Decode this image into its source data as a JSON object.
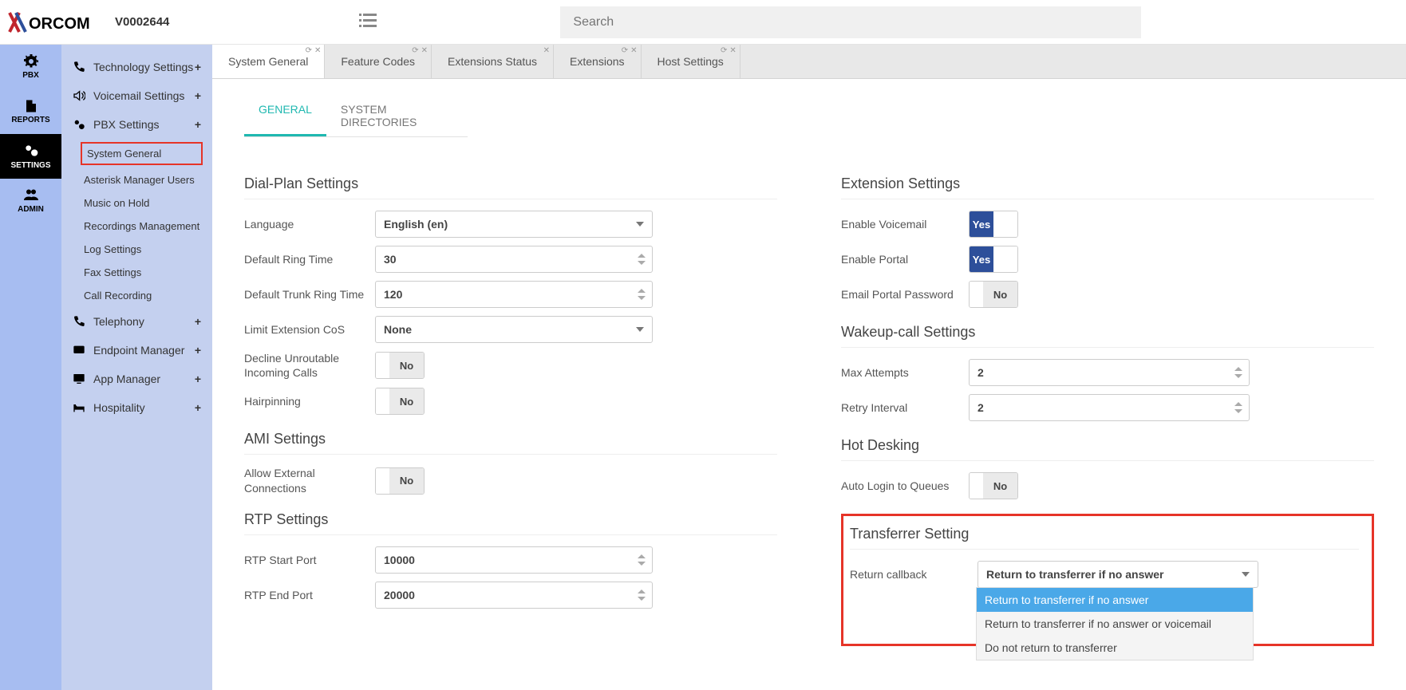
{
  "brand": {
    "name": "XORCOM",
    "version": "V0002644"
  },
  "search": {
    "placeholder": "Search"
  },
  "rail": [
    {
      "id": "pbx",
      "label": "PBX"
    },
    {
      "id": "reports",
      "label": "REPORTS"
    },
    {
      "id": "settings",
      "label": "SETTINGS"
    },
    {
      "id": "admin",
      "label": "ADMIN"
    }
  ],
  "sidebar": {
    "groups": [
      {
        "id": "tech",
        "label": "Technology Settings"
      },
      {
        "id": "voicemail",
        "label": "Voicemail Settings"
      },
      {
        "id": "pbx",
        "label": "PBX Settings"
      }
    ],
    "pbx_subs": [
      {
        "id": "sysgen",
        "label": "System General",
        "hl": true
      },
      {
        "id": "ami",
        "label": "Asterisk Manager Users"
      },
      {
        "id": "moh",
        "label": "Music on Hold"
      },
      {
        "id": "rec",
        "label": "Recordings Management"
      },
      {
        "id": "log",
        "label": "Log Settings"
      },
      {
        "id": "fax",
        "label": "Fax Settings"
      },
      {
        "id": "callrec",
        "label": "Call Recording"
      }
    ],
    "groups2": [
      {
        "id": "tel",
        "label": "Telephony"
      },
      {
        "id": "endpoint",
        "label": "Endpoint Manager"
      },
      {
        "id": "appmgr",
        "label": "App Manager"
      },
      {
        "id": "hosp",
        "label": "Hospitality"
      }
    ]
  },
  "tabs": [
    {
      "id": "sysgen",
      "label": "System General",
      "active": true
    },
    {
      "id": "feat",
      "label": "Feature Codes"
    },
    {
      "id": "extstat",
      "label": "Extensions Status"
    },
    {
      "id": "ext",
      "label": "Extensions"
    },
    {
      "id": "host",
      "label": "Host Settings"
    }
  ],
  "subtabs": {
    "general": "GENERAL",
    "sysdir": "SYSTEM DIRECTORIES"
  },
  "left": {
    "dialplan": {
      "title": "Dial-Plan Settings",
      "language_label": "Language",
      "language_value": "English (en)",
      "defring_label": "Default Ring Time",
      "defring_value": "30",
      "deftrunk_label": "Default Trunk Ring Time",
      "deftrunk_value": "120",
      "limitcos_label": "Limit Extension CoS",
      "limitcos_value": "None",
      "decline_label": "Decline Unroutable Incoming Calls",
      "decline_value": "No",
      "hairpin_label": "Hairpinning",
      "hairpin_value": "No"
    },
    "ami": {
      "title": "AMI Settings",
      "allowext_label": "Allow External Connections",
      "allowext_value": "No"
    },
    "rtp": {
      "title": "RTP Settings",
      "start_label": "RTP Start Port",
      "start_value": "10000",
      "end_label": "RTP End Port",
      "end_value": "20000"
    }
  },
  "right": {
    "ext": {
      "title": "Extension Settings",
      "vm_label": "Enable Voicemail",
      "vm_value": "Yes",
      "portal_label": "Enable Portal",
      "portal_value": "Yes",
      "email_label": "Email Portal Password",
      "email_value": "No"
    },
    "wakeup": {
      "title": "Wakeup-call Settings",
      "max_label": "Max Attempts",
      "max_value": "2",
      "retry_label": "Retry Interval",
      "retry_value": "2"
    },
    "hotdesk": {
      "title": "Hot Desking",
      "auto_label": "Auto Login to Queues",
      "auto_value": "No"
    },
    "transfer": {
      "title": "Transferrer Setting",
      "return_label": "Return callback",
      "return_value": "Return to transferrer if no answer",
      "options": [
        "Return to transferrer if no answer",
        "Return to transferrer if no answer or voicemail",
        "Do not return to transferrer"
      ]
    }
  }
}
